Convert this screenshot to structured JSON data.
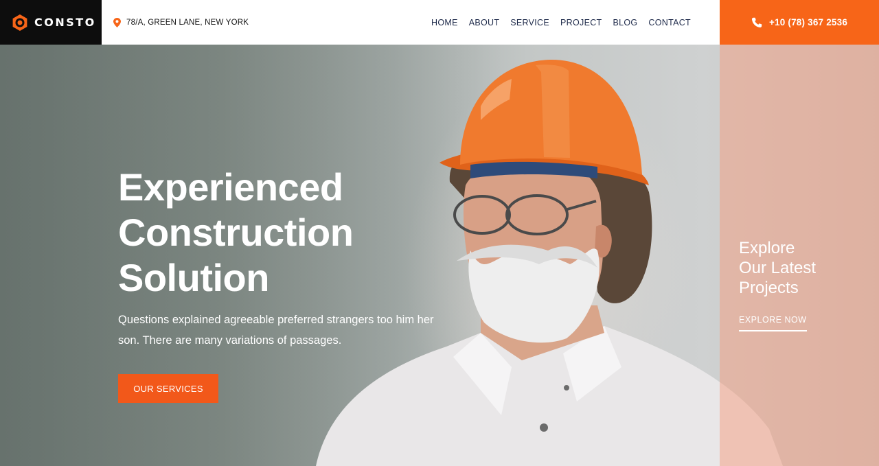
{
  "header": {
    "logo": {
      "text": "CONSTO",
      "icon": "hexagon-logo-icon"
    },
    "address": {
      "icon": "map-pin-icon",
      "text": "78/A, GREEN LANE, NEW YORK"
    },
    "nav": [
      {
        "label": "HOME"
      },
      {
        "label": "ABOUT"
      },
      {
        "label": "SERVICE"
      },
      {
        "label": "PROJECT"
      },
      {
        "label": "BLOG"
      },
      {
        "label": "CONTACT"
      }
    ],
    "phone": {
      "icon": "phone-icon",
      "text": "+10 (78) 367 2536"
    }
  },
  "hero": {
    "title_lines": [
      "Experienced",
      "Construction",
      "Solution"
    ],
    "description": "Questions explained agreeable preferred strangers too him her son. There are many variations of passages.",
    "cta_label": "OUR SERVICES",
    "image": "worker-hardhat-photo"
  },
  "side_panel": {
    "title_lines": [
      "Explore",
      "Our Latest",
      "Projects"
    ],
    "link_label": "EXPLORE NOW"
  },
  "colors": {
    "accent": "#f76518",
    "button": "#f2581a",
    "nav_text": "#1e2a4a",
    "logo_bg": "#0d0d0d"
  }
}
